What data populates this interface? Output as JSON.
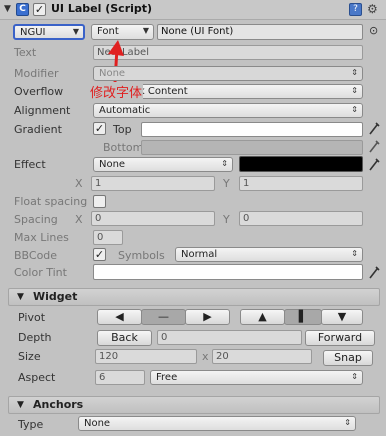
{
  "header": {
    "title": "UI Label (Script)",
    "component_checked": true
  },
  "font_row": {
    "ngui_label": "NGUI",
    "font_label": "Font",
    "font_value": "None (UI Font)"
  },
  "annotation": {
    "text": "修改字体",
    "color": "#e02020"
  },
  "props": {
    "text_label": "Text",
    "text_value": "New Label",
    "modifier_label": "Modifier",
    "modifier_value": "None",
    "overflow_label": "Overflow",
    "overflow_value": "Shrink Content",
    "alignment_label": "Alignment",
    "alignment_value": "Automatic",
    "gradient_label": "Gradient",
    "gradient_top": "Top",
    "gradient_bottom": "Bottom",
    "effect_label": "Effect",
    "effect_value": "None",
    "effect_x_label": "X",
    "effect_x": "1",
    "effect_y_label": "Y",
    "effect_y": "1",
    "float_spacing_label": "Float spacing",
    "spacing_label": "Spacing",
    "spacing_x_label": "X",
    "spacing_x": "0",
    "spacing_y_label": "Y",
    "spacing_y": "0",
    "max_lines_label": "Max Lines",
    "max_lines": "0",
    "bbcode_label": "BBCode",
    "symbols_label": "Symbols",
    "symbols_value": "Normal",
    "color_tint_label": "Color Tint"
  },
  "widget": {
    "title": "Widget",
    "pivot_label": "Pivot",
    "depth_label": "Depth",
    "back_label": "Back",
    "depth_value": "0",
    "forward_label": "Forward",
    "size_label": "Size",
    "width": "120",
    "x_sep": "x",
    "height": "20",
    "snap_label": "Snap",
    "aspect_label": "Aspect",
    "aspect_value": "6",
    "aspect_mode": "Free"
  },
  "anchors": {
    "title": "Anchors",
    "type_label": "Type",
    "type_value": "None"
  },
  "colors": {
    "effect_color": "#000000",
    "tint_color": "#ffffff",
    "gradient_top": "#ffffff",
    "gradient_bottom": "#b5b5b5"
  }
}
